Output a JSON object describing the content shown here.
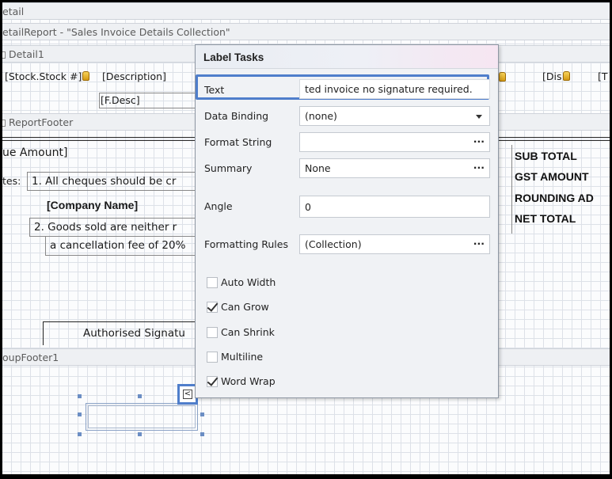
{
  "designer": {
    "band_detail_header": "etail",
    "band_detail_report": "etailReport - \"Sales Invoice Details Collection\"",
    "band_detail1": "Detail1",
    "band_report_footer": "ReportFooter",
    "band_group_footer": "oupFooter1",
    "field_stock": "[Stock.Stock #]",
    "field_description": "[Description]",
    "field_fdesc": "[F.Desc]",
    "field_dis": "[Dis",
    "field_t": "[T",
    "field_due_amount": "ue Amount]",
    "notes_label": "tes:",
    "note1": "1. All cheques should be cr",
    "company_name": "[Company Name]",
    "note2": "2. Goods sold are neither r",
    "note2b": "a cancellation fee of 20%",
    "authorised": "Authorised Signatu",
    "totals": [
      "SUB TOTAL",
      "GST AMOUNT",
      "ROUNDING AD",
      "NET TOTAL"
    ]
  },
  "panel": {
    "title": "Label Tasks",
    "rows": {
      "text": {
        "label": "Text",
        "value": "ted invoice no signature required."
      },
      "data_binding": {
        "label": "Data Binding",
        "value": "(none)"
      },
      "format_string": {
        "label": "Format String",
        "value": "",
        "button": "···"
      },
      "summary": {
        "label": "Summary",
        "value": "None",
        "button": "···"
      },
      "angle": {
        "label": "Angle",
        "value": "0"
      },
      "formatting_rules": {
        "label": "Formatting Rules",
        "value": "(Collection)",
        "button": "···"
      }
    },
    "checkboxes": [
      {
        "label": "Auto Width",
        "checked": false
      },
      {
        "label": "Can Grow",
        "checked": true
      },
      {
        "label": "Can Shrink",
        "checked": false
      },
      {
        "label": "Multiline",
        "checked": false
      },
      {
        "label": "Word Wrap",
        "checked": true
      }
    ]
  },
  "smart_tag": {
    "glyph": "<"
  },
  "colors": {
    "highlight": "#4f7ecb",
    "grid": "#dde1e8",
    "band": "#eef0f3"
  }
}
